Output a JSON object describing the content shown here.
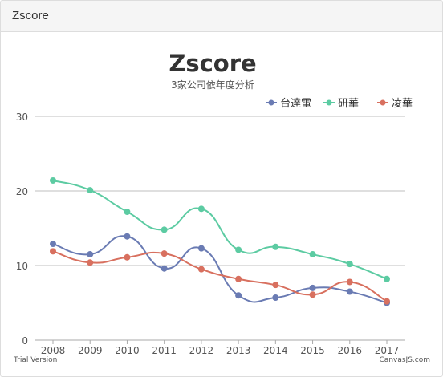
{
  "panel": {
    "title": "Zscore"
  },
  "colors": {
    "series": [
      "#6a7bb3",
      "#5ccba2",
      "#d8705f"
    ],
    "grid": "#bfbfbf"
  },
  "chart_data": {
    "type": "line",
    "title": "Zscore",
    "subtitle": "3家公司依年度分析",
    "categories": [
      "2008",
      "2009",
      "2010",
      "2011",
      "2012",
      "2013",
      "2014",
      "2015",
      "2016",
      "2017"
    ],
    "ylim": [
      0,
      30
    ],
    "yticks": [
      "0",
      "10",
      "20",
      "30"
    ],
    "grid": true,
    "legend": "top-right",
    "series": [
      {
        "name": "台達電",
        "values": [
          12.9,
          11.5,
          13.9,
          9.6,
          12.3,
          6.0,
          5.7,
          7.0,
          6.5,
          5.0
        ]
      },
      {
        "name": "研華",
        "values": [
          21.4,
          20.1,
          17.2,
          14.8,
          17.6,
          12.1,
          12.5,
          11.5,
          10.2,
          8.2
        ]
      },
      {
        "name": "凌華",
        "values": [
          11.9,
          10.4,
          11.1,
          11.6,
          9.5,
          8.2,
          7.4,
          6.1,
          7.8,
          5.2
        ]
      }
    ]
  },
  "footer": {
    "left": "Trial Version",
    "right": "CanvasJS.com"
  }
}
